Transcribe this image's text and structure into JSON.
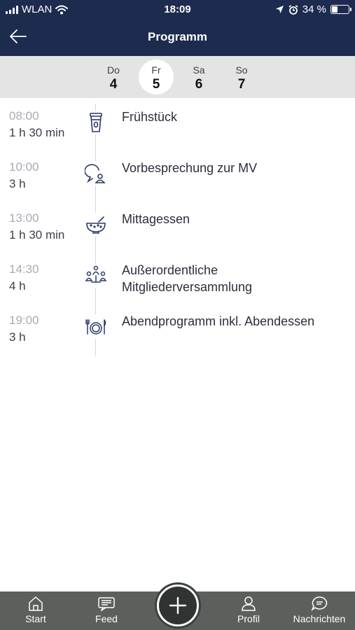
{
  "status_bar": {
    "carrier": "WLAN",
    "time": "18:09",
    "battery": "34 %",
    "battery_level": 0.34,
    "icons": [
      "signal-icon",
      "wifi-icon",
      "location-icon",
      "alarm-icon",
      "battery-icon"
    ]
  },
  "header": {
    "title": "Programm",
    "back_icon": "arrow-left-icon"
  },
  "days": [
    {
      "name": "Do",
      "num": "4",
      "active": false
    },
    {
      "name": "Fr",
      "num": "5",
      "active": true
    },
    {
      "name": "Sa",
      "num": "6",
      "active": false
    },
    {
      "name": "So",
      "num": "7",
      "active": false
    }
  ],
  "events": [
    {
      "time": "08:00",
      "duration": "1 h 30 min",
      "title": "Frühstück",
      "icon": "coffee-cup-icon"
    },
    {
      "time": "10:00",
      "duration": "3 h",
      "title": "Vorbesprechung zur MV",
      "icon": "meeting-chat-icon"
    },
    {
      "time": "13:00",
      "duration": "1 h 30 min",
      "title": "Mittagessen",
      "icon": "soup-bowl-icon"
    },
    {
      "time": "14:30",
      "duration": "4 h",
      "title": "Außerordentliche Mitgliederversammlung",
      "icon": "assembly-people-icon"
    },
    {
      "time": "19:00",
      "duration": "3 h",
      "title": "Abendprogramm inkl. Abendessen",
      "icon": "plate-cutlery-icon"
    }
  ],
  "tabbar": {
    "tabs": [
      {
        "label": "Start",
        "icon": "home-icon"
      },
      {
        "label": "Feed",
        "icon": "feed-icon"
      },
      {
        "label": "Profil",
        "icon": "profile-icon"
      },
      {
        "label": "Nachrichten",
        "icon": "messages-icon"
      }
    ],
    "fab_icon": "plus-icon"
  },
  "colors": {
    "header_bg": "#1d2b4f",
    "days_bg": "#e4e4e4",
    "tabbar_bg": "#5b605d",
    "icon_stroke": "#2b3a66",
    "time_muted": "#a8abb3"
  }
}
